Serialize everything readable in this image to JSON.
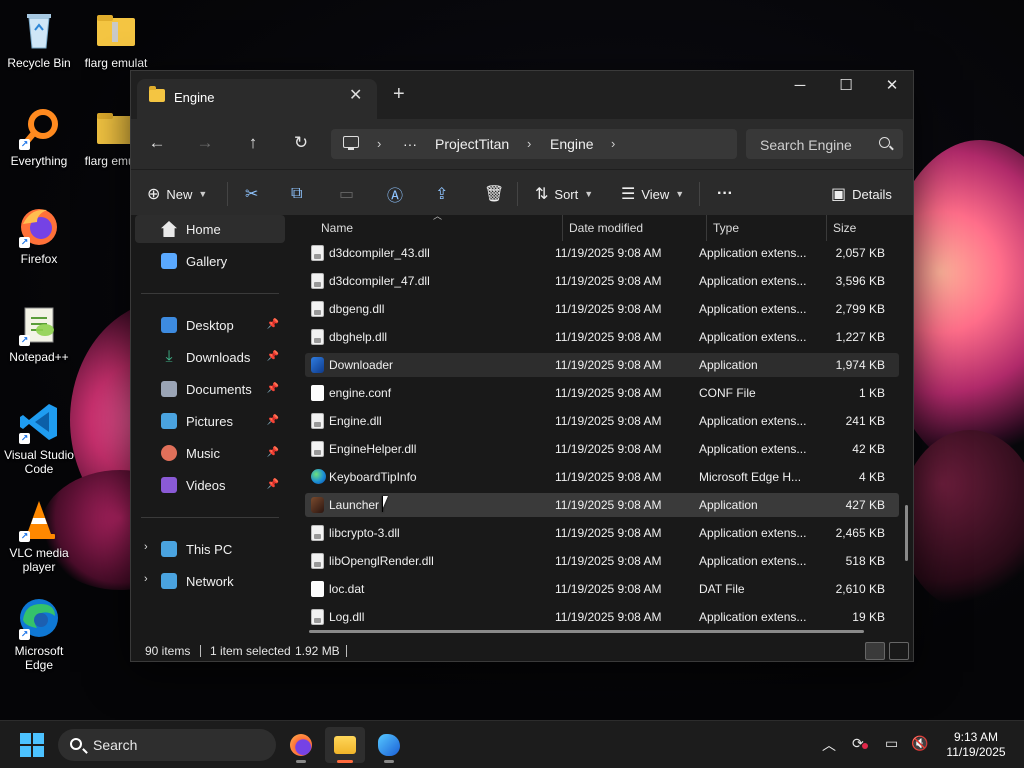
{
  "desktop": {
    "icons": [
      {
        "label": "Recycle Bin"
      },
      {
        "label": "Everything"
      },
      {
        "label": "Firefox"
      },
      {
        "label": "Notepad++"
      },
      {
        "label": "Visual Studio Code"
      },
      {
        "label": "VLC media player"
      },
      {
        "label": "Microsoft Edge"
      },
      {
        "label": "flarg emulat"
      },
      {
        "label": "flarg emulat"
      }
    ]
  },
  "window": {
    "tab_title": "Engine",
    "new_tab": "+",
    "controls": {
      "minimize": "─",
      "maximize": "☐",
      "close": "✕"
    },
    "breadcrumb": [
      "ProjectTitan",
      "Engine"
    ],
    "breadcrumb_more": "···",
    "search_placeholder": "Search Engine",
    "toolbar": {
      "new_label": "New",
      "sort_label": "Sort",
      "view_label": "View",
      "more_label": "···",
      "details_label": "Details"
    },
    "sidebar": {
      "top": [
        {
          "label": "Home",
          "selected": true,
          "color": "#e8e8e8"
        },
        {
          "label": "Gallery",
          "selected": false,
          "color": "#5aa9ff"
        }
      ],
      "pinned": [
        {
          "label": "Desktop",
          "color": "#3d8be0"
        },
        {
          "label": "Downloads",
          "color": "#3fb68b"
        },
        {
          "label": "Documents",
          "color": "#9aa4b5"
        },
        {
          "label": "Pictures",
          "color": "#4aa3df"
        },
        {
          "label": "Music",
          "color": "#e0705a"
        },
        {
          "label": "Videos",
          "color": "#8a5ad6"
        }
      ],
      "bottom": [
        {
          "label": "This PC",
          "color": "#4aa3df"
        },
        {
          "label": "Network",
          "color": "#4aa3df"
        }
      ]
    },
    "columns": {
      "name": "Name",
      "date": "Date modified",
      "type": "Type",
      "size": "Size"
    },
    "files": [
      {
        "name": "d3dcompiler_43.dll",
        "date": "11/19/2025 9:08 AM",
        "type": "Application extens...",
        "size": "2,057 KB",
        "icon": "dll"
      },
      {
        "name": "d3dcompiler_47.dll",
        "date": "11/19/2025 9:08 AM",
        "type": "Application extens...",
        "size": "3,596 KB",
        "icon": "dll"
      },
      {
        "name": "dbgeng.dll",
        "date": "11/19/2025 9:08 AM",
        "type": "Application extens...",
        "size": "2,799 KB",
        "icon": "dll"
      },
      {
        "name": "dbghelp.dll",
        "date": "11/19/2025 9:08 AM",
        "type": "Application extens...",
        "size": "1,227 KB",
        "icon": "dll"
      },
      {
        "name": "Downloader",
        "date": "11/19/2025 9:08 AM",
        "type": "Application",
        "size": "1,974 KB",
        "icon": "app"
      },
      {
        "name": "engine.conf",
        "date": "11/19/2025 9:08 AM",
        "type": "CONF File",
        "size": "1 KB",
        "icon": "doc"
      },
      {
        "name": "Engine.dll",
        "date": "11/19/2025 9:08 AM",
        "type": "Application extens...",
        "size": "241 KB",
        "icon": "dll"
      },
      {
        "name": "EngineHelper.dll",
        "date": "11/19/2025 9:08 AM",
        "type": "Application extens...",
        "size": "42 KB",
        "icon": "dll"
      },
      {
        "name": "KeyboardTipInfo",
        "date": "11/19/2025 9:08 AM",
        "type": "Microsoft Edge H...",
        "size": "4 KB",
        "icon": "edge"
      },
      {
        "name": "Launcher",
        "date": "11/19/2025 9:08 AM",
        "type": "Application",
        "size": "427 KB",
        "icon": "launch"
      },
      {
        "name": "libcrypto-3.dll",
        "date": "11/19/2025 9:08 AM",
        "type": "Application extens...",
        "size": "2,465 KB",
        "icon": "dll"
      },
      {
        "name": "libOpenglRender.dll",
        "date": "11/19/2025 9:08 AM",
        "type": "Application extens...",
        "size": "518 KB",
        "icon": "dll"
      },
      {
        "name": "loc.dat",
        "date": "11/19/2025 9:08 AM",
        "type": "DAT File",
        "size": "2,610 KB",
        "icon": "doc"
      },
      {
        "name": "Log.dll",
        "date": "11/19/2025 9:08 AM",
        "type": "Application extens...",
        "size": "19 KB",
        "icon": "dll"
      }
    ],
    "status": {
      "items": "90 items",
      "selected": "1 item selected",
      "size": "1.92 MB"
    }
  },
  "taskbar": {
    "search_label": "Search",
    "time": "9:13 AM",
    "date": "11/19/2025"
  }
}
